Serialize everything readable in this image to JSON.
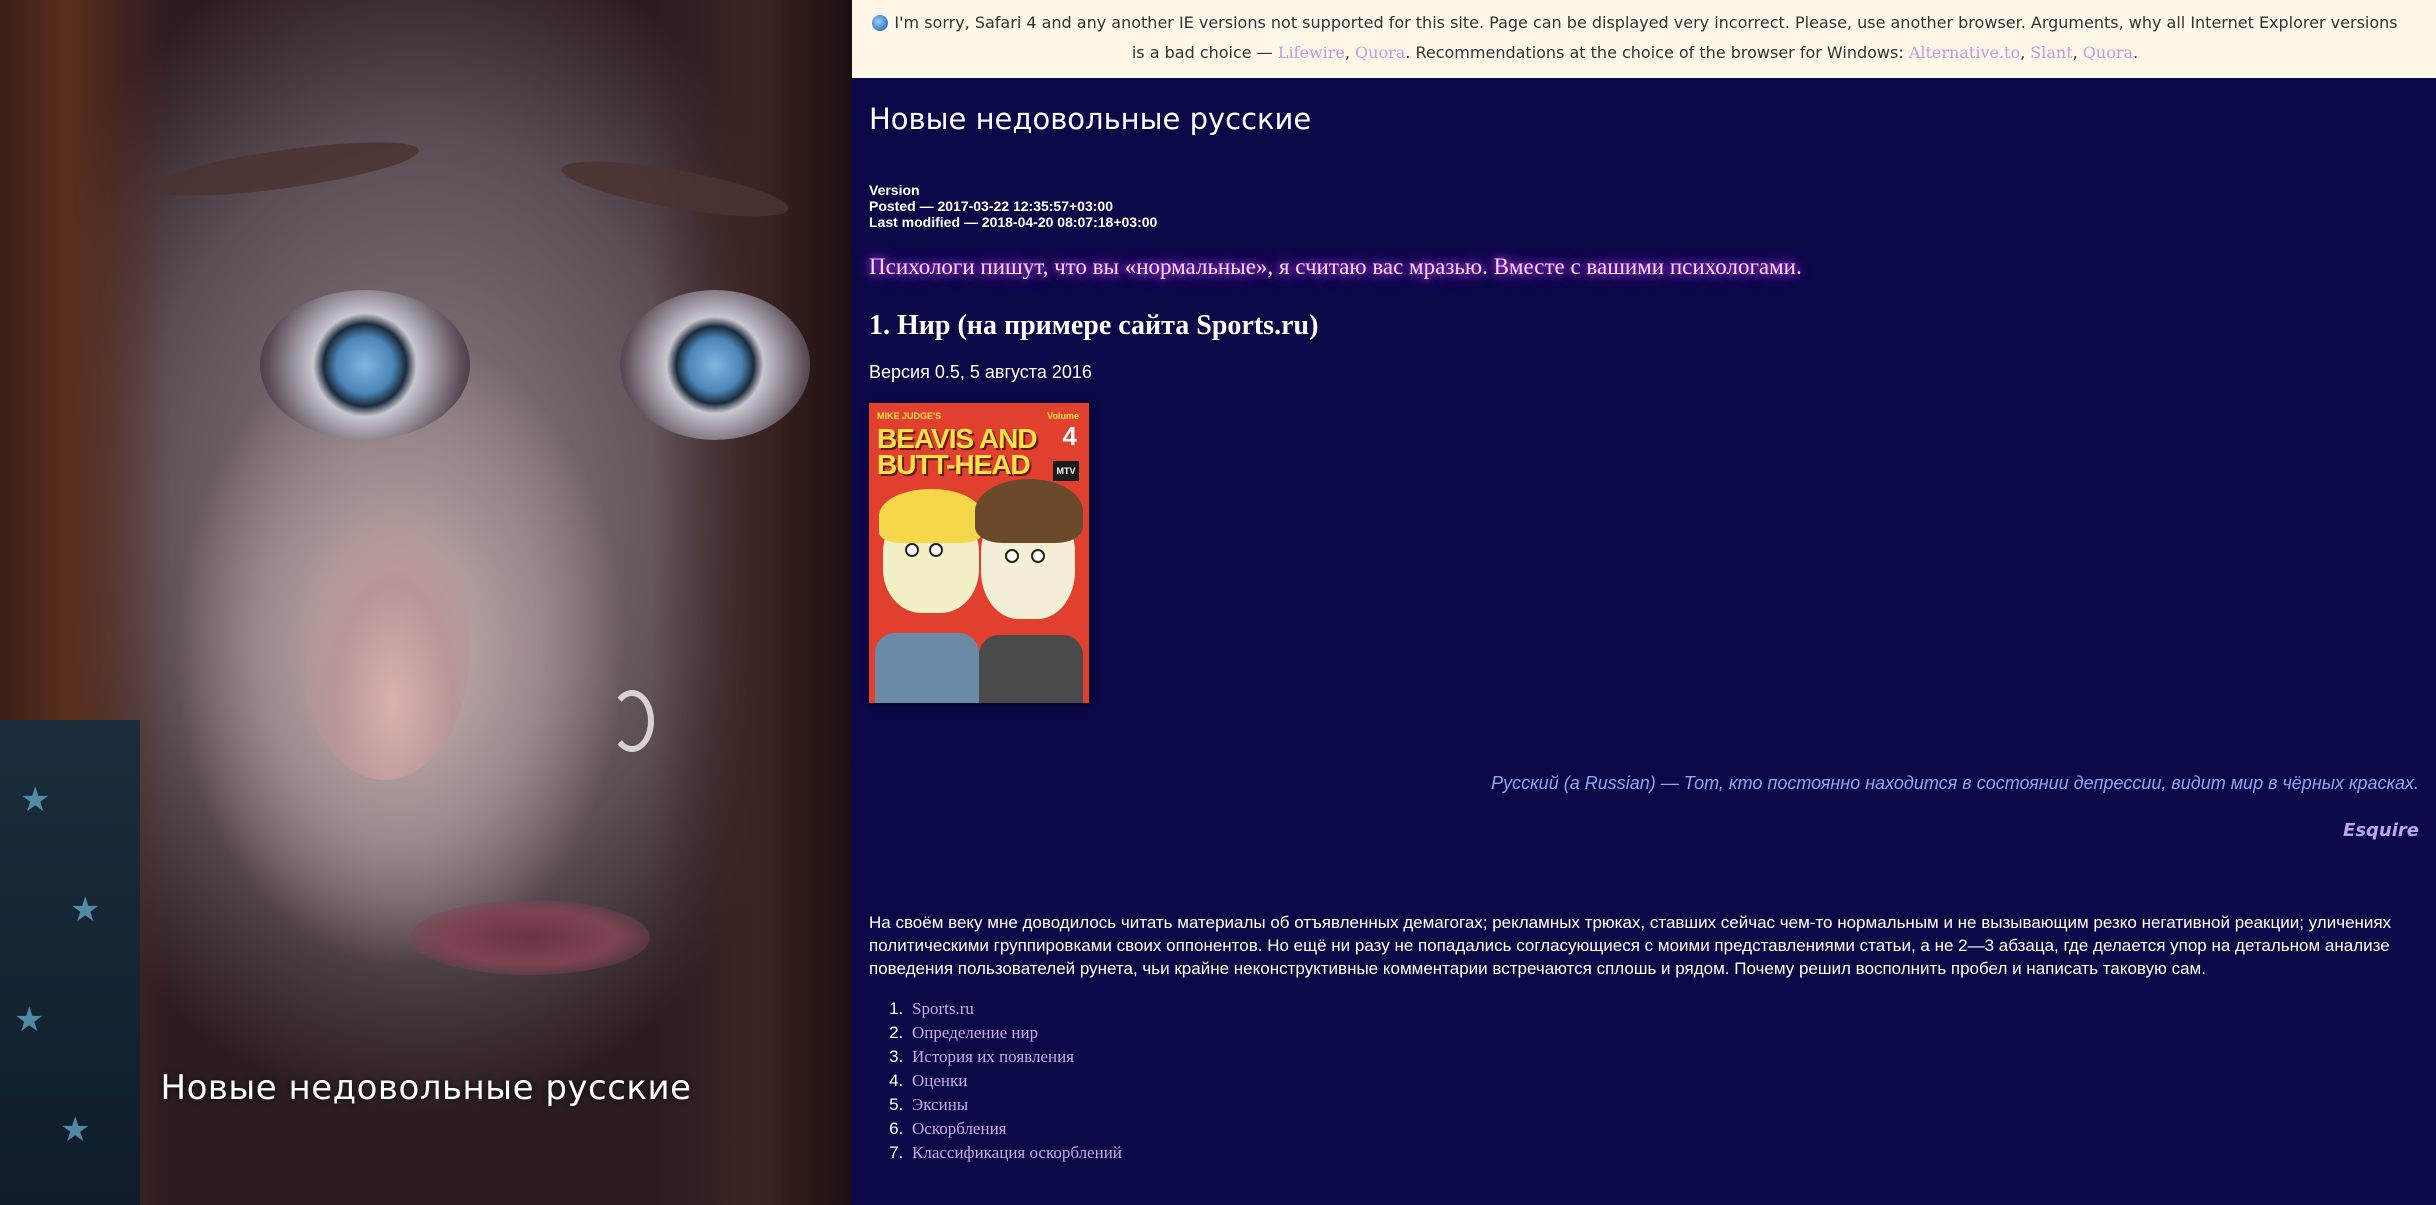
{
  "photo": {
    "caption": "Новые недовольные русские"
  },
  "banner": {
    "text_before": "I'm sorry, Safari 4 and any another IE versions not supported for this site. Page can be displayed very incorrect. Please, use another browser. Arguments, why all Internet Explorer versions is a bad choice — ",
    "link_lifewire": "Lifewire",
    "sep1": ", ",
    "link_quora": "Quora",
    "text_mid": ". Recommendations at the choice of the browser for Windows: ",
    "link_alternativeto": "Alternative.to",
    "sep2": ", ",
    "link_slant": "Slant",
    "sep3": ", ",
    "link_quora2": "Quora",
    "end": "."
  },
  "header": {
    "site_title": "Новые недовольные русские"
  },
  "meta": {
    "version": "Version",
    "posted": "Posted — 2017-03-22 12:35:57+03:00",
    "modified": "Last modified — 2018-04-20 08:07:18+03:00"
  },
  "lead_quote": "Психологи пишут, что вы «нормальные», я считаю вас мразью. Вместе с вашими психологами.",
  "article": {
    "title": "1. Нир (на примере сайта Sports.ru)",
    "version_line": "Версия 0.5, 5 августа 2016"
  },
  "cover": {
    "top_label": "MIKE JUDGE'S",
    "volume_label": "Volume",
    "volume_number": "4",
    "line1": "BEAVIS AND",
    "line2": "BUTT-HEAD",
    "mtv": "MTV"
  },
  "epigraph": {
    "text": "Русский (а Russian) — Тот, кто постоянно находится в состоянии депрессии, видит мир в чёрных красках.",
    "source": "Esquire"
  },
  "body": {
    "paragraph": "На своём веку мне доводилось читать материалы об отъявленных демагогах; рекламных трюках, ставших сейчас чем-то нормальным и не вызывающим резко негативной реакции; уличениях политическими группировками своих оппонентов. Но ещё ни разу не попадались согласующиеся с моими представлениями статьи, а не 2—3 абзаца, где делается упор на детальном анализе поведения пользователей рунета, чьи крайне неконструктивные комментарии встречаются сплошь и рядом. Почему решил восполнить пробел и написать таковую сам."
  },
  "toc": [
    "Sports.ru",
    "Определение нир",
    "История их появления",
    "Оценки",
    "Эксины",
    "Оскорбления",
    "Классификация оскорблений"
  ],
  "colors": {
    "background": "#0b0848",
    "banner_bg": "#fdf7e8",
    "link": "#c79bdc",
    "glow": "#d24bff",
    "epigraph": "#8ea6f0"
  }
}
